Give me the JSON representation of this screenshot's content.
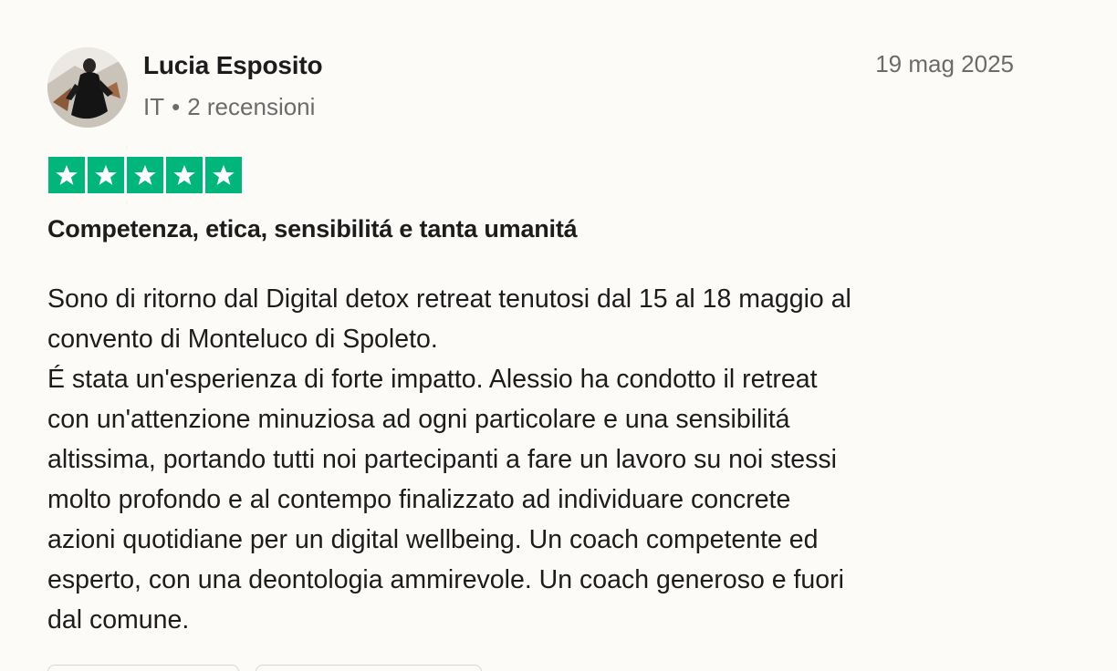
{
  "reviewer": {
    "name": "Lucia Esposito",
    "country": "IT",
    "separator": "•",
    "reviews": "2 recensioni",
    "avatar": "reviewer-photo"
  },
  "review": {
    "date": "19 mag 2025",
    "rating": 5,
    "rating_max": 5,
    "star_color": "#00b67a",
    "title": "Competenza, etica, sensibilitá e tanta umanitá",
    "body_lines": [
      "Sono di ritorno dal Digital detox retreat tenutosi dal 15 al 18 maggio al",
      "convento di Monteluco di Spoleto.",
      "É stata un'esperienza di forte impatto. Alessio ha condotto il retreat",
      "con un'attenzione minuziosa ad ogni particolare e una sensibilitá",
      "altissima, portando tutti noi partecipanti a fare un lavoro su noi stessi",
      "molto profondo e al contempo finalizzato ad individuare concrete",
      "azioni quotidiane per un digital wellbeing. Un coach competente ed",
      "esperto, con una deontologia ammirevole. Un coach generoso e fuori",
      "dal comune."
    ]
  }
}
